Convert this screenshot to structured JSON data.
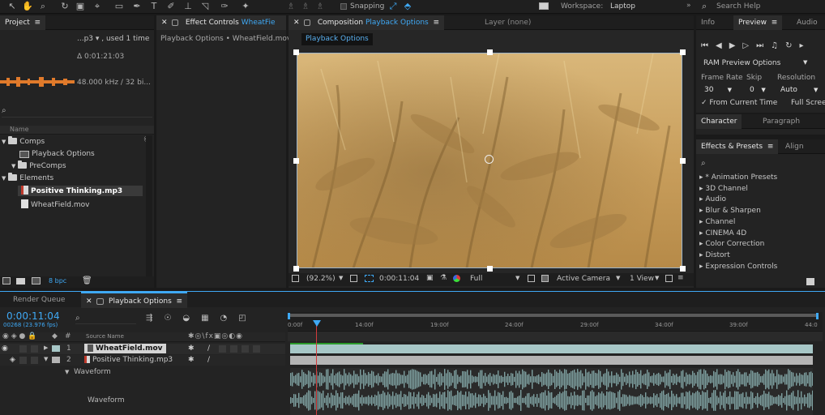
{
  "toolbar": {
    "snapping_label": "Snapping",
    "workspace_label": "Workspace:",
    "workspace_value": "Laptop",
    "search_placeholder": "Search Help",
    "tools": [
      "selection-tool-icon",
      "hand-tool-icon",
      "zoom-tool-icon",
      "rotate-tool-icon",
      "camera-tool-icon",
      "pan-behind-tool-icon",
      "rectangle-tool-icon",
      "pen-tool-icon",
      "type-tool-icon",
      "brush-tool-icon",
      "clone-stamp-tool-icon",
      "eraser-tool-icon",
      "roto-brush-tool-icon",
      "puppet-pin-tool-icon"
    ]
  },
  "project": {
    "tab_label": "Project",
    "file_name": "...p3 ▾ , used 1 time",
    "duration": "Δ 0:01:21:03",
    "audio_info": "48.000 kHz / 32 bi...",
    "column_name": "Name",
    "tree": [
      {
        "label": "Comps",
        "type": "folder",
        "indent": 0,
        "expanded": true
      },
      {
        "label": "Playback Options",
        "type": "comp",
        "indent": 1
      },
      {
        "label": "PreComps",
        "type": "folder",
        "indent": 1,
        "expanded": true
      },
      {
        "label": "Elements",
        "type": "folder",
        "indent": 0,
        "expanded": true
      },
      {
        "label": "Positive Thinking.mp3",
        "type": "audio",
        "indent": 1,
        "selected": true
      },
      {
        "label": "WheatField.mov",
        "type": "video",
        "indent": 1
      }
    ],
    "bpc": "8 bpc"
  },
  "effect_controls": {
    "tab_prefix": "Effect Controls",
    "tab_layer": "WheatFie",
    "breadcrumb": "Playback Options • WheatField.mov"
  },
  "composition": {
    "tab_prefix": "Composition",
    "tab_name": "Playback Options",
    "layer_tab": "Layer (none)",
    "comp_tab_label": "Playback Options",
    "zoom": "(92.2%)",
    "timecode": "0:00:11:04",
    "resolution": "Full",
    "camera": "Active Camera",
    "view": "1 View"
  },
  "right_panel": {
    "tabs": [
      "Info",
      "Preview",
      "Audio"
    ],
    "active_tab": "Preview",
    "ram_preview": "RAM Preview Options",
    "frame_rate_label": "Frame Rate",
    "skip_label": "Skip",
    "resolution_label": "Resolution",
    "frame_rate_value": "30",
    "skip_value": "0",
    "resolution_value": "Auto",
    "from_current_time": "From Current Time",
    "full_screen": "Full Scree",
    "char_tabs": [
      "Character",
      "Paragraph"
    ],
    "effects_tabs": [
      "Effects & Presets",
      "Align"
    ],
    "effects_list": [
      "* Animation Presets",
      "3D Channel",
      "Audio",
      "Blur & Sharpen",
      "Channel",
      "CINEMA 4D",
      "Color Correction",
      "Distort",
      "Expression Controls"
    ]
  },
  "timeline": {
    "tabs": [
      "Render Queue",
      "Playback Options"
    ],
    "timecode": "0:00:11:04",
    "frame_info": "00268 (23.976 fps)",
    "col_source_name": "Source Name",
    "ruler": [
      "0:00f",
      "14:00f",
      "19:00f",
      "24:00f",
      "29:00f",
      "34:00f",
      "39:00f",
      "44:0"
    ],
    "layers": [
      {
        "num": "1",
        "name": "WheatField.mov",
        "color": "#a7c7c7",
        "selected": true
      },
      {
        "num": "2",
        "name": "Positive Thinking.mp3",
        "color": "#b4b4b4",
        "selected": false
      }
    ],
    "waveform_label": "Waveform",
    "waveform_sub_label": "Waveform"
  },
  "colors": {
    "accent": "#3fa9f5",
    "panel_bg": "#232323",
    "wheat": "#c9a262",
    "audio_waveform": "#7fa1a1"
  }
}
